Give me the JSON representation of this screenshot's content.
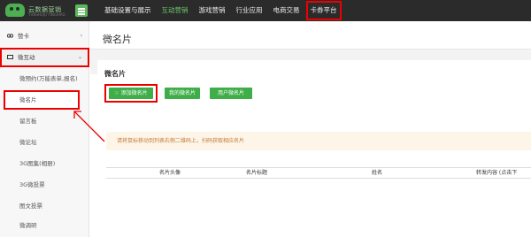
{
  "header": {
    "logo_text": "云数据营销",
    "logo_sub": "YUNSHUJU YINGXIAO",
    "nav": [
      {
        "label": "基础设置与展示",
        "active": false,
        "highlighted": false
      },
      {
        "label": "互动营销",
        "active": true,
        "highlighted": false
      },
      {
        "label": "游戏营销",
        "active": false,
        "highlighted": false
      },
      {
        "label": "行业应用",
        "active": false,
        "highlighted": false
      },
      {
        "label": "电商交易",
        "active": false,
        "highlighted": false
      },
      {
        "label": "卡券平台",
        "active": false,
        "highlighted": true
      }
    ]
  },
  "sidebar": {
    "items": [
      {
        "label": "赞卡",
        "chevron": "‹"
      },
      {
        "label": "微互动",
        "chevron": "⌄"
      },
      {
        "label": "微预约(万能表单,报名)"
      },
      {
        "label": "微名片"
      },
      {
        "label": "留言板"
      },
      {
        "label": "微论坛"
      },
      {
        "label": "3G图集(相册)"
      },
      {
        "label": "3G微投票"
      },
      {
        "label": "图文投票"
      },
      {
        "label": "微调研"
      }
    ]
  },
  "main": {
    "page_title": "微名片",
    "panel_title": "微名片",
    "buttons": {
      "add": "添加微名片",
      "mine": "我的微名片",
      "user": "用户微名片"
    },
    "notice": "请将鼠标移动到列表右侧二维码上，扫码获取相应名片",
    "table_headers": [
      "名片头像",
      "名片标题",
      "姓名",
      "转发内容 (点击下"
    ]
  },
  "colors": {
    "topbar": "#2b2b2b",
    "accent_green": "#3fae49",
    "annotation_red": "#e00000",
    "notice_bg": "#fdf5e8",
    "notice_text": "#c47a3a"
  }
}
